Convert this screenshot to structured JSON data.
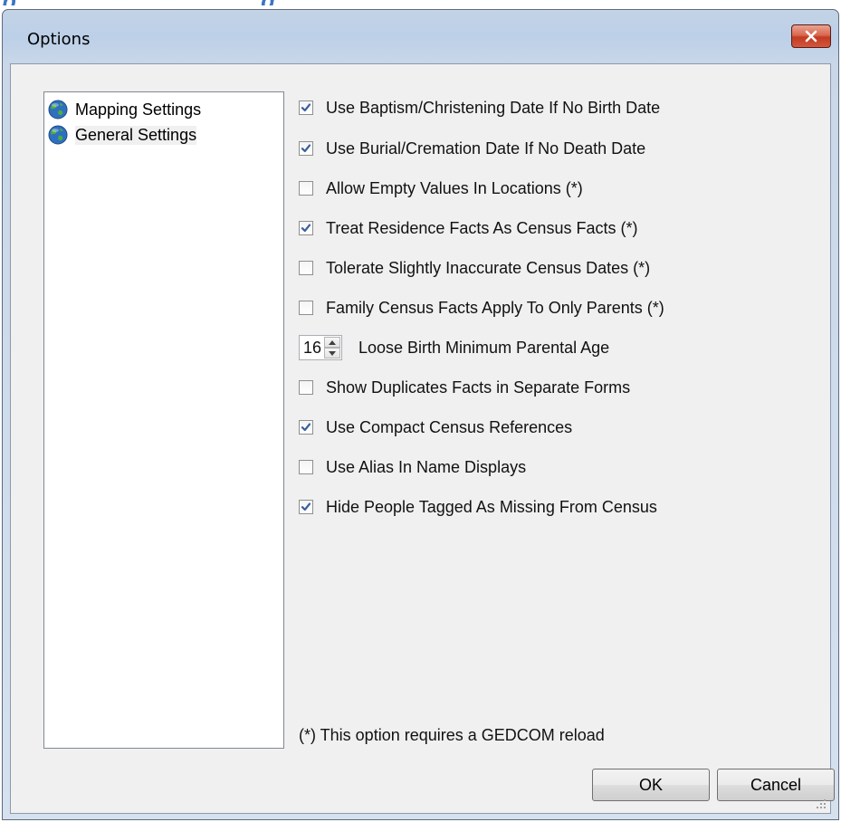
{
  "window": {
    "title": "Options",
    "close_icon": "close-icon"
  },
  "tree": {
    "items": [
      {
        "label": "Mapping Settings",
        "icon": "globe-icon",
        "selected": false
      },
      {
        "label": "General Settings",
        "icon": "globe-icon",
        "selected": true
      }
    ]
  },
  "options": {
    "baptism": {
      "label": "Use Baptism/Christening Date If No Birth Date",
      "checked": true
    },
    "burial": {
      "label": "Use Burial/Cremation Date If No Death Date",
      "checked": true
    },
    "empty_locations": {
      "label": "Allow Empty Values In Locations (*)",
      "checked": false
    },
    "residence": {
      "label": "Treat Residence Facts As Census Facts (*)",
      "checked": true
    },
    "tolerate": {
      "label": "Tolerate Slightly Inaccurate Census Dates (*)",
      "checked": false
    },
    "family_census": {
      "label": "Family Census Facts Apply To Only Parents (*)",
      "checked": false
    },
    "parental_age": {
      "label": "Loose Birth Minimum Parental Age",
      "value": "16"
    },
    "duplicates": {
      "label": "Show Duplicates Facts in Separate Forms",
      "checked": false
    },
    "compact": {
      "label": "Use Compact Census References",
      "checked": true
    },
    "alias": {
      "label": "Use Alias In Name Displays",
      "checked": false
    },
    "hide_missing": {
      "label": "Hide People Tagged As Missing From Census",
      "checked": true
    }
  },
  "footnote": "(*) This option requires a GEDCOM reload",
  "buttons": {
    "ok": "OK",
    "cancel": "Cancel"
  },
  "colors": {
    "check": "#3a5f9c",
    "title_bar": "#c4d3e6",
    "close_button": "#c23b22"
  }
}
